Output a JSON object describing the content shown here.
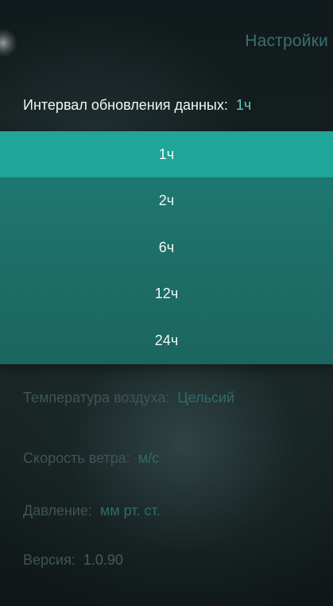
{
  "header": {
    "title": "Настройки",
    "back_icon": "back-circle-icon"
  },
  "settings": {
    "interval": {
      "label": "Интервал обновления данных:",
      "value": "1ч"
    },
    "temperature": {
      "label": "Температура воздуха:",
      "value": "Цельсий"
    },
    "wind": {
      "label": "Скорость ветра:",
      "value": "м/с"
    },
    "pressure": {
      "label": "Давление:",
      "value": "мм рт. ст."
    },
    "version": {
      "label": "Версия:",
      "value": "1.0.90"
    }
  },
  "interval_dropdown": {
    "selected": "1ч",
    "options": [
      "1ч",
      "2ч",
      "6ч",
      "12ч",
      "24ч"
    ]
  },
  "colors": {
    "accent": "#5fd0c6",
    "dropdown_bg": "#1d7069",
    "selected_option_bg": "#1fa599",
    "title": "#3d6e70"
  }
}
